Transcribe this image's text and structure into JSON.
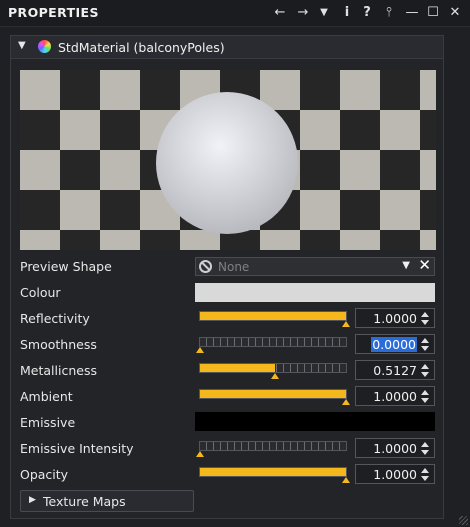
{
  "window": {
    "title": "PROPERTIES",
    "buttons": {
      "back": "←",
      "forward": "→",
      "menu": "▼",
      "info": "i",
      "help": "?",
      "pin": "⫯",
      "minimize": "—",
      "maximize": "☐",
      "close": "✕"
    }
  },
  "material": {
    "collapse_glyph": "▼",
    "title": "StdMaterial (balconyPoles)"
  },
  "preview_shape": {
    "label": "Preview Shape",
    "value": "None",
    "dropdown_glyph": "▼",
    "clear_glyph": "✕"
  },
  "colour": {
    "label": "Colour",
    "color": "#d9d9d9"
  },
  "sliders": [
    {
      "label": "Reflectivity",
      "fraction": 1.0,
      "value": "1.0000",
      "selected": false
    },
    {
      "label": "Smoothness",
      "fraction": 0.0,
      "value": "0.0000",
      "selected": true
    },
    {
      "label": "Metallicness",
      "fraction": 0.5127,
      "value": "0.5127",
      "selected": false
    },
    {
      "label": "Ambient",
      "fraction": 1.0,
      "value": "1.0000",
      "selected": false
    }
  ],
  "emissive": {
    "label": "Emissive",
    "color": "#000000"
  },
  "sliders2": [
    {
      "label": "Emissive Intensity",
      "fraction": 0.0,
      "value": "1.0000",
      "selected": false
    },
    {
      "label": "Opacity",
      "fraction": 1.0,
      "value": "1.0000",
      "selected": false
    }
  ],
  "texture_maps": {
    "glyph": "▶",
    "label": "Texture Maps"
  },
  "colors": {
    "accent_slider": "#f5b81c",
    "selection": "#2a6dd9"
  }
}
